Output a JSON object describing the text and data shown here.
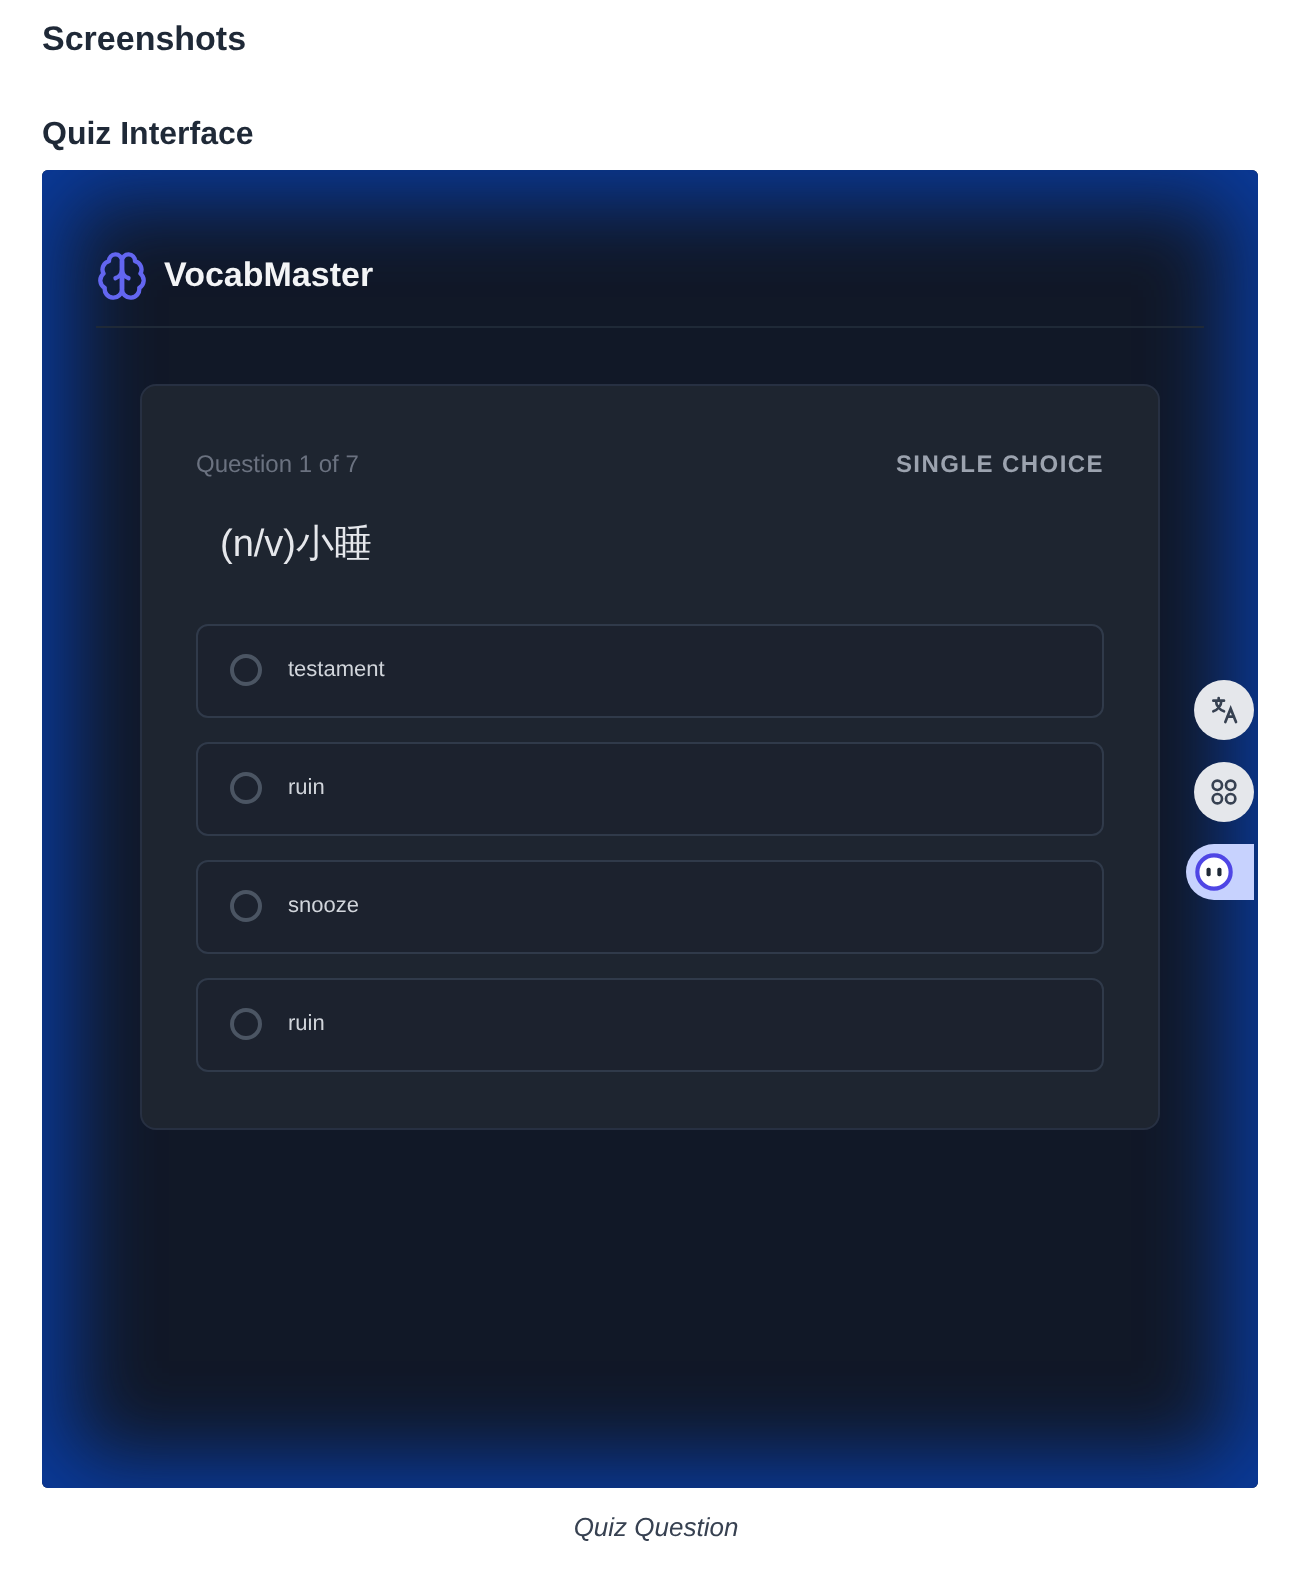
{
  "section_title": "Screenshots",
  "screenshot": {
    "title": "Quiz Interface",
    "caption": "Quiz Question",
    "app": {
      "brand": "VocabMaster",
      "quiz": {
        "progress": "Question 1 of 7",
        "type_label": "SINGLE CHOICE",
        "prompt": "(n/v)小睡",
        "options": [
          {
            "label": "testament",
            "selected": false
          },
          {
            "label": "ruin",
            "selected": false
          },
          {
            "label": "snooze",
            "selected": false
          },
          {
            "label": "ruin",
            "selected": false
          }
        ]
      },
      "side_buttons": [
        {
          "kind": "translate",
          "active": false
        },
        {
          "kind": "apps",
          "active": false
        },
        {
          "kind": "assistant",
          "active": true
        }
      ]
    }
  }
}
